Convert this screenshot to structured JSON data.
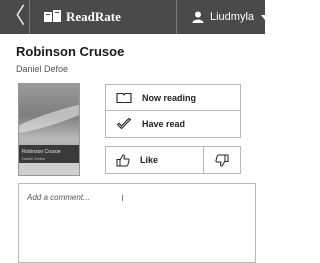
{
  "header": {
    "back_glyph": "〈",
    "app_name": "ReadRate",
    "logo_icon": "books-icon",
    "user_icon": "user-icon",
    "user_name": "Liudmyla",
    "background_color": "#4a4a4a"
  },
  "book": {
    "title": "Robinson Crusoe",
    "author": "Daniel Defoe",
    "cover": {
      "title": "Robinson Crusoe",
      "author": "Daniel Defoe"
    }
  },
  "actions": {
    "now_reading": {
      "label": "Now reading",
      "icon": "book-outline-icon"
    },
    "have_read": {
      "label": "Have read",
      "icon": "check-mark-icon"
    },
    "like": {
      "label": "Like",
      "icon": "thumbs-up-icon"
    },
    "dislike": {
      "icon": "thumbs-down-icon"
    }
  },
  "comment": {
    "placeholder": "Add a comment..."
  }
}
